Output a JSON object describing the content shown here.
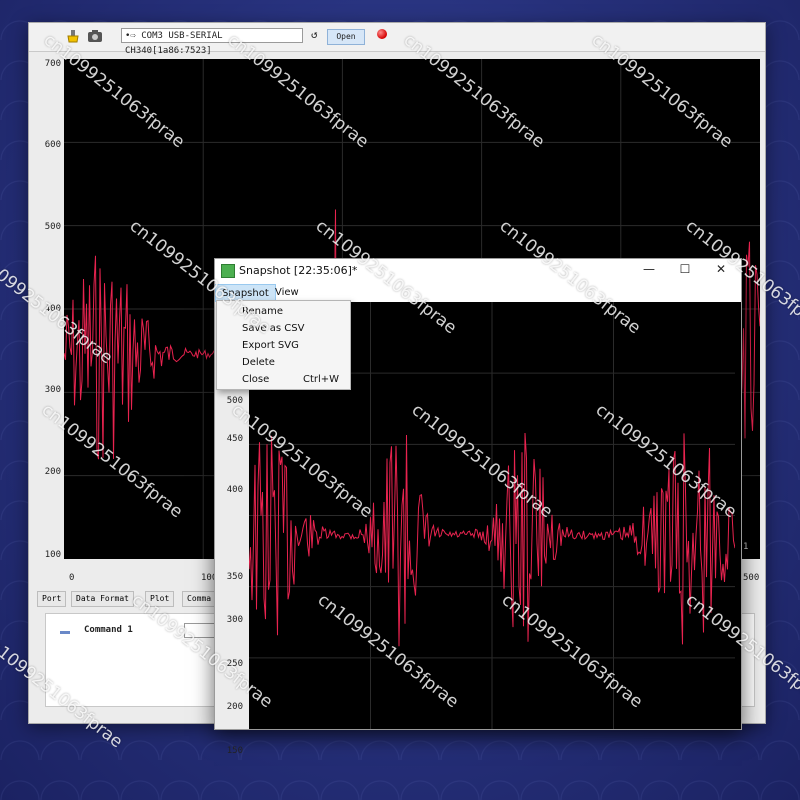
{
  "toolbar": {
    "port_select": "•⇨ COM3 USB-SERIAL CH340[1a86:7523]",
    "open_label": "Open"
  },
  "main_plot": {
    "y_ticks": [
      "700",
      "600",
      "500",
      "400",
      "300",
      "200",
      "100"
    ],
    "x_ticks": [
      "0",
      "100",
      "500"
    ],
    "partial_label": "1"
  },
  "tabs": [
    {
      "label": "Port"
    },
    {
      "label": "Data Format"
    },
    {
      "label": "Plot"
    },
    {
      "label": "Comma"
    }
  ],
  "commands": {
    "item1_label": "Command 1"
  },
  "snapshot": {
    "title": "Snapshot [22:35:06]*",
    "menu": {
      "snapshot": "Snapshot",
      "view": "View",
      "items": [
        {
          "label": "Rename",
          "shortcut": ""
        },
        {
          "label": "Save as CSV",
          "shortcut": ""
        },
        {
          "label": "Export SVG",
          "shortcut": ""
        },
        {
          "label": "Delete",
          "shortcut": ""
        },
        {
          "label": "Close",
          "shortcut": "Ctrl+W"
        }
      ]
    },
    "y_ticks": [
      "500",
      "450",
      "400",
      "350",
      "300",
      "250",
      "200",
      "150"
    ]
  },
  "watermark": "cn1099251063fprae",
  "colors": {
    "signal": "#e8234f",
    "plot_bg": "#000000",
    "grid": "#2b2b2b",
    "background": "#26307a"
  }
}
